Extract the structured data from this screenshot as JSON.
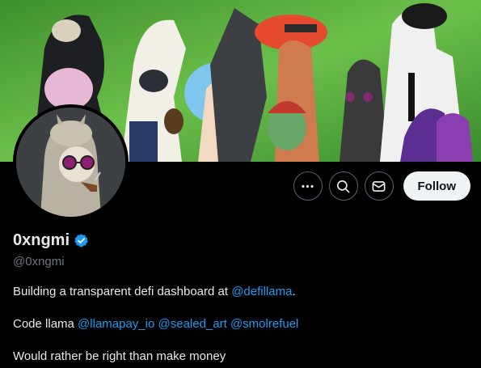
{
  "profile": {
    "display_name": "0xngmi",
    "handle": "@0xngmi",
    "verified": true
  },
  "bio": {
    "line1_text": "Building a transparent defi dashboard at ",
    "line1_mention": "@defillama",
    "line1_suffix": ".",
    "line2_text": "Code llama ",
    "line2_mentions": [
      "@llamapay_io",
      "@sealed_art",
      "@smolrefuel"
    ],
    "line3_text": "Would rather be right than make money"
  },
  "actions": {
    "follow_label": "Follow",
    "icons": [
      "more-icon",
      "search-icon",
      "message-icon"
    ]
  },
  "colors": {
    "accent": "#1d9bf0",
    "follow_bg": "#eff3f4",
    "banner_green": "#4fa83a"
  }
}
